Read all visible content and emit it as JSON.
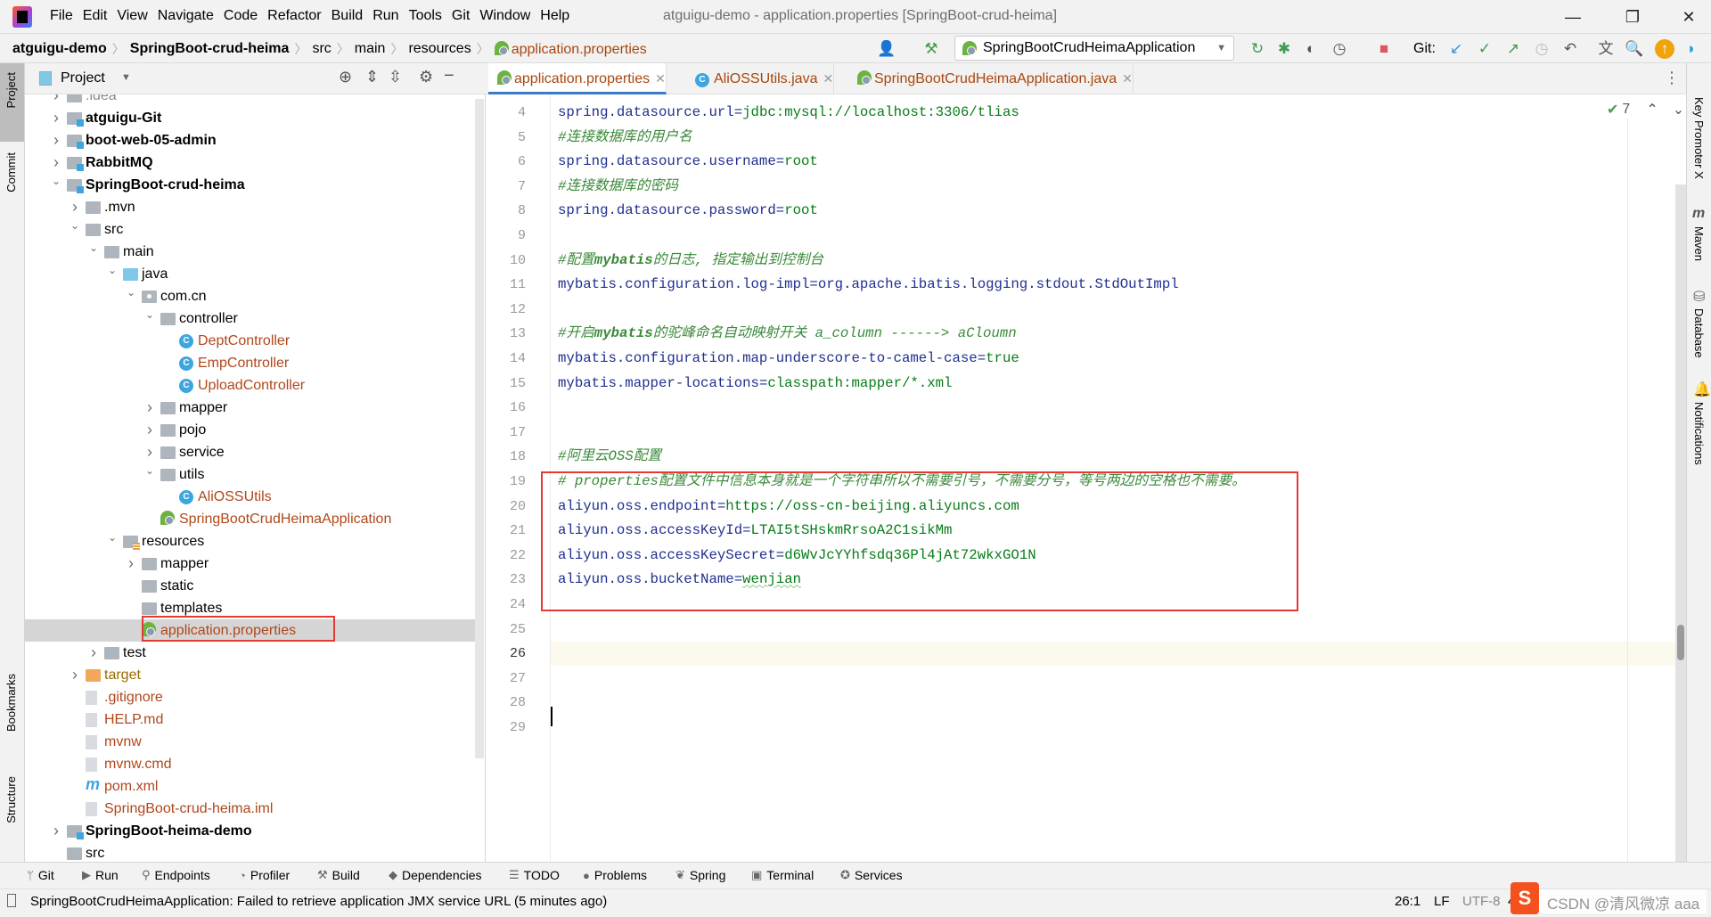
{
  "menubar": {
    "items": [
      "File",
      "Edit",
      "View",
      "Navigate",
      "Code",
      "Refactor",
      "Build",
      "Run",
      "Tools",
      "Git",
      "Window",
      "Help"
    ],
    "title": "atguigu-demo - application.properties [SpringBoot-crud-heima]"
  },
  "breadcrumb": [
    "atguigu-demo",
    "SpringBoot-crud-heima",
    "src",
    "main",
    "resources",
    "application.properties"
  ],
  "toolbar": {
    "run_config": "SpringBootCrudHeimaApplication",
    "git_label": "Git:"
  },
  "left_stripe": {
    "project": "Project",
    "commit": "Commit",
    "bookmarks": "Bookmarks",
    "structure": "Structure"
  },
  "project_panel": {
    "title": "Project",
    "tree": [
      {
        "level": 0,
        "arrow": "right",
        "icon": "folder",
        "label": ".idea",
        "style": "partial"
      },
      {
        "level": 0,
        "arrow": "right",
        "icon": "module",
        "label": "atguigu-Git",
        "style": "bold"
      },
      {
        "level": 0,
        "arrow": "right",
        "icon": "module",
        "label": "boot-web-05-admin",
        "style": "bold"
      },
      {
        "level": 0,
        "arrow": "right",
        "icon": "module",
        "label": "RabbitMQ",
        "style": "bold"
      },
      {
        "level": 0,
        "arrow": "down",
        "icon": "module",
        "label": "SpringBoot-crud-heima",
        "style": "bold"
      },
      {
        "level": 1,
        "arrow": "right",
        "icon": "folder",
        "label": ".mvn"
      },
      {
        "level": 1,
        "arrow": "down",
        "icon": "folder",
        "label": "src"
      },
      {
        "level": 2,
        "arrow": "down",
        "icon": "folder",
        "label": "main"
      },
      {
        "level": 3,
        "arrow": "down",
        "icon": "folder-blue",
        "label": "java"
      },
      {
        "level": 4,
        "arrow": "down",
        "icon": "package",
        "label": "com.cn"
      },
      {
        "level": 5,
        "arrow": "down",
        "icon": "folder",
        "label": "controller"
      },
      {
        "level": 6,
        "arrow": "none",
        "icon": "class",
        "label": "DeptController",
        "style": "brown"
      },
      {
        "level": 6,
        "arrow": "none",
        "icon": "class",
        "label": "EmpController",
        "style": "brown"
      },
      {
        "level": 6,
        "arrow": "none",
        "icon": "class",
        "label": "UploadController",
        "style": "brown"
      },
      {
        "level": 5,
        "arrow": "right",
        "icon": "folder",
        "label": "mapper"
      },
      {
        "level": 5,
        "arrow": "right",
        "icon": "folder",
        "label": "pojo"
      },
      {
        "level": 5,
        "arrow": "right",
        "icon": "folder",
        "label": "service"
      },
      {
        "level": 5,
        "arrow": "down",
        "icon": "folder",
        "label": "utils"
      },
      {
        "level": 6,
        "arrow": "none",
        "icon": "class",
        "label": "AliOSSUtils",
        "style": "brown"
      },
      {
        "level": 5,
        "arrow": "none",
        "icon": "spring",
        "label": "SpringBootCrudHeimaApplication",
        "style": "brown"
      },
      {
        "level": 3,
        "arrow": "down",
        "icon": "folder-res",
        "label": "resources"
      },
      {
        "level": 4,
        "arrow": "right",
        "icon": "folder",
        "label": "mapper"
      },
      {
        "level": 4,
        "arrow": "none",
        "icon": "folder",
        "label": "static"
      },
      {
        "level": 4,
        "arrow": "none",
        "icon": "folder",
        "label": "templates"
      },
      {
        "level": 4,
        "arrow": "none",
        "icon": "spring",
        "label": "application.properties",
        "style": "brown",
        "selected": true
      },
      {
        "level": 2,
        "arrow": "right",
        "icon": "folder",
        "label": "test"
      },
      {
        "level": 1,
        "arrow": "right",
        "icon": "folder-orange",
        "label": "target",
        "style": "orange"
      },
      {
        "level": 1,
        "arrow": "none",
        "icon": "file",
        "label": ".gitignore",
        "style": "brown"
      },
      {
        "level": 1,
        "arrow": "none",
        "icon": "file",
        "label": "HELP.md",
        "style": "brown"
      },
      {
        "level": 1,
        "arrow": "none",
        "icon": "file",
        "label": "mvnw",
        "style": "brown"
      },
      {
        "level": 1,
        "arrow": "none",
        "icon": "file",
        "label": "mvnw.cmd",
        "style": "brown"
      },
      {
        "level": 1,
        "arrow": "none",
        "icon": "maven",
        "label": "pom.xml",
        "style": "brown"
      },
      {
        "level": 1,
        "arrow": "none",
        "icon": "file",
        "label": "SpringBoot-crud-heima.iml",
        "style": "brown"
      },
      {
        "level": 0,
        "arrow": "right",
        "icon": "module",
        "label": "SpringBoot-heima-demo",
        "style": "bold"
      },
      {
        "level": 0,
        "arrow": "none",
        "icon": "folder",
        "label": "src"
      }
    ]
  },
  "editor": {
    "tabs": [
      {
        "label": "application.properties",
        "active": true,
        "icon": "spring"
      },
      {
        "label": "AliOSSUtils.java",
        "icon": "class"
      },
      {
        "label": "SpringBootCrudHeimaApplication.java",
        "icon": "spring"
      }
    ],
    "inspection_count": "7",
    "current_line": 26,
    "lines": [
      {
        "n": "4",
        "parts": [
          {
            "t": "spring.datasource.url",
            "c": "k"
          },
          {
            "t": "=",
            "c": "k"
          },
          {
            "t": "jdbc:mysql://localhost:3306/tlias",
            "c": "v"
          }
        ]
      },
      {
        "n": "5",
        "parts": [
          {
            "t": "#连接数据库的用户名",
            "c": "cm"
          }
        ]
      },
      {
        "n": "6",
        "parts": [
          {
            "t": "spring.datasource.username",
            "c": "k"
          },
          {
            "t": "=",
            "c": "k"
          },
          {
            "t": "root",
            "c": "v"
          }
        ]
      },
      {
        "n": "7",
        "parts": [
          {
            "t": "#连接数据库的密码",
            "c": "cm"
          }
        ]
      },
      {
        "n": "8",
        "parts": [
          {
            "t": "spring.datasource.password",
            "c": "k"
          },
          {
            "t": "=",
            "c": "k"
          },
          {
            "t": "root",
            "c": "v"
          }
        ]
      },
      {
        "n": "9",
        "parts": []
      },
      {
        "n": "10",
        "parts": [
          {
            "t": "#配置",
            "c": "cm"
          },
          {
            "t": "mybatis",
            "c": "cmb"
          },
          {
            "t": "的日志, 指定输出到控制台",
            "c": "cm"
          }
        ]
      },
      {
        "n": "11",
        "parts": [
          {
            "t": "mybatis.configuration.log-impl",
            "c": "k"
          },
          {
            "t": "=",
            "c": "k"
          },
          {
            "t": "org.apache.ibatis.logging.stdout.StdOutImpl",
            "c": "k"
          }
        ]
      },
      {
        "n": "12",
        "parts": []
      },
      {
        "n": "13",
        "parts": [
          {
            "t": "#开启",
            "c": "cm"
          },
          {
            "t": "mybatis",
            "c": "cmb"
          },
          {
            "t": "的驼峰命名自动映射开关 a_column ------> aCloumn",
            "c": "cm"
          }
        ]
      },
      {
        "n": "14",
        "parts": [
          {
            "t": "mybatis.configuration.map-underscore-to-camel-case",
            "c": "k"
          },
          {
            "t": "=",
            "c": "k"
          },
          {
            "t": "true",
            "c": "v"
          }
        ]
      },
      {
        "n": "15",
        "parts": [
          {
            "t": "mybatis.mapper-locations",
            "c": "k"
          },
          {
            "t": "=",
            "c": "k"
          },
          {
            "t": "classpath:mapper/*.xml",
            "c": "v"
          }
        ]
      },
      {
        "n": "16",
        "parts": []
      },
      {
        "n": "17",
        "parts": []
      },
      {
        "n": "18",
        "parts": [
          {
            "t": "#阿里云OSS配置",
            "c": "cm"
          }
        ]
      },
      {
        "n": "19",
        "parts": [
          {
            "t": "# properties配置文件中信息本身就是一个字符串所以不需要引号，不需要分号，等号两边的空格也不需要。",
            "c": "cm"
          }
        ]
      },
      {
        "n": "20",
        "parts": [
          {
            "t": "aliyun.oss.endpoint",
            "c": "k"
          },
          {
            "t": "=",
            "c": "k"
          },
          {
            "t": "https://oss-cn-beijing.aliyuncs.com",
            "c": "v"
          }
        ]
      },
      {
        "n": "21",
        "parts": [
          {
            "t": "aliyun.oss.accessKeyId",
            "c": "k"
          },
          {
            "t": "=",
            "c": "k"
          },
          {
            "t": "LTAI5tSHskmRrsoA2C1sikMm",
            "c": "v"
          }
        ]
      },
      {
        "n": "22",
        "parts": [
          {
            "t": "aliyun.oss.accessKeySecret",
            "c": "k"
          },
          {
            "t": "=",
            "c": "k"
          },
          {
            "t": "d6WvJcYYhfsdq36Pl4jAt72wkxGO1N",
            "c": "v"
          }
        ]
      },
      {
        "n": "23",
        "parts": [
          {
            "t": "aliyun.oss.bucketName",
            "c": "k"
          },
          {
            "t": "=",
            "c": "k"
          },
          {
            "t": "wenjian",
            "c": "v squig"
          }
        ]
      },
      {
        "n": "24",
        "parts": []
      },
      {
        "n": "25",
        "parts": []
      },
      {
        "n": "26",
        "parts": []
      },
      {
        "n": "27",
        "parts": []
      },
      {
        "n": "28",
        "parts": []
      },
      {
        "n": "29",
        "parts": []
      }
    ]
  },
  "right_stripe": [
    "Key Promoter X",
    "Maven",
    "Database",
    "Notifications"
  ],
  "bottom_tools": [
    {
      "label": "Git",
      "icon": "git-branch-icon",
      "glyph": "ᛘ"
    },
    {
      "label": "Run",
      "icon": "run-icon",
      "glyph": "▶"
    },
    {
      "label": "Endpoints",
      "icon": "endpoints-icon",
      "glyph": "⚲"
    },
    {
      "label": "Profiler",
      "icon": "profiler-icon",
      "glyph": "◔"
    },
    {
      "label": "Build",
      "icon": "hammer-icon",
      "glyph": "⚒"
    },
    {
      "label": "Dependencies",
      "icon": "dependencies-icon",
      "glyph": "◆"
    },
    {
      "label": "TODO",
      "icon": "todo-icon",
      "glyph": "☰"
    },
    {
      "label": "Problems",
      "icon": "problems-icon",
      "glyph": "●"
    },
    {
      "label": "Spring",
      "icon": "spring-icon",
      "glyph": "❦"
    },
    {
      "label": "Terminal",
      "icon": "terminal-icon",
      "glyph": "▣"
    },
    {
      "label": "Services",
      "icon": "services-icon",
      "glyph": "✪"
    }
  ],
  "status": {
    "message": "SpringBootCrudHeimaApplication: Failed to retrieve application JMX service URL (5 minutes ago)",
    "position": "26:1",
    "line_sep": "LF",
    "encoding": "UTF-8",
    "indent": "4"
  },
  "watermark": "CSDN @清风微凉 aaa",
  "colors": {
    "accent": "#3c7bc8",
    "highlight_box": "#e53935",
    "key": "#1f2f8f",
    "value": "#067d17",
    "comment": "#3a8a3a"
  }
}
